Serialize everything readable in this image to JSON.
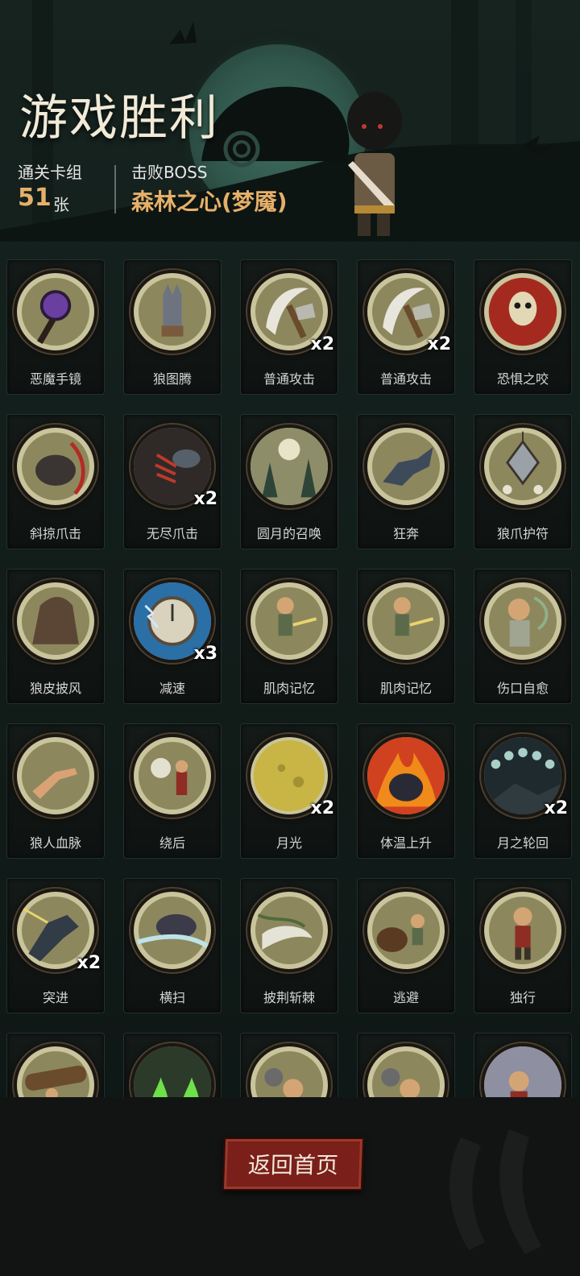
{
  "header": {
    "title": "游戏胜利",
    "deck_label": "通关卡组",
    "deck_count": "51",
    "deck_unit": "张",
    "boss_label": "击败BOSS",
    "boss_name": "森林之心(梦魇)"
  },
  "cards": [
    {
      "name": "恶魔手镜",
      "count": "",
      "icon": "purple-mirror-icon"
    },
    {
      "name": "狼图腾",
      "count": "",
      "icon": "wolf-totem-icon"
    },
    {
      "name": "普通攻击",
      "count": "x2",
      "icon": "axe-slash-icon"
    },
    {
      "name": "普通攻击",
      "count": "x2",
      "icon": "axe-slash-icon"
    },
    {
      "name": "恐惧之咬",
      "count": "",
      "icon": "demon-skull-icon"
    },
    {
      "name": "斜掠爪击",
      "count": "",
      "icon": "werewolf-claw-icon"
    },
    {
      "name": "无尽爪击",
      "count": "x2",
      "icon": "claw-strike-icon"
    },
    {
      "name": "圆月的召唤",
      "count": "",
      "icon": "full-moon-forest-icon"
    },
    {
      "name": "狂奔",
      "count": "",
      "icon": "running-wolf-icon"
    },
    {
      "name": "狼爪护符",
      "count": "",
      "icon": "claw-amulet-icon"
    },
    {
      "name": "狼皮披风",
      "count": "",
      "icon": "wolf-cloak-icon"
    },
    {
      "name": "减速",
      "count": "x3",
      "icon": "clock-lightning-icon"
    },
    {
      "name": "肌肉记忆",
      "count": "",
      "icon": "boy-arrows-icon"
    },
    {
      "name": "肌肉记忆",
      "count": "",
      "icon": "boy-arrows-icon"
    },
    {
      "name": "伤口自愈",
      "count": "",
      "icon": "healing-boy-icon"
    },
    {
      "name": "狼人血脉",
      "count": "",
      "icon": "werewolf-hand-icon"
    },
    {
      "name": "绕后",
      "count": "",
      "icon": "skeleton-ambush-icon"
    },
    {
      "name": "月光",
      "count": "x2",
      "icon": "moonlight-icon"
    },
    {
      "name": "体温上升",
      "count": "",
      "icon": "fire-wolf-icon"
    },
    {
      "name": "月之轮回",
      "count": "x2",
      "icon": "moon-phases-icon"
    },
    {
      "name": "突进",
      "count": "x2",
      "icon": "lunging-wolf-icon"
    },
    {
      "name": "横扫",
      "count": "",
      "icon": "wolf-sweep-icon"
    },
    {
      "name": "披荆斩棘",
      "count": "",
      "icon": "thorn-axe-icon"
    },
    {
      "name": "逃避",
      "count": "",
      "icon": "bear-chase-icon"
    },
    {
      "name": "独行",
      "count": "",
      "icon": "lone-boy-icon"
    },
    {
      "name": "",
      "count": "",
      "icon": "log-carry-icon"
    },
    {
      "name": "",
      "count": "",
      "icon": "green-fire-icon"
    },
    {
      "name": "",
      "count": "",
      "icon": "boy-rock-icon"
    },
    {
      "name": "",
      "count": "",
      "icon": "boy-rock-icon"
    },
    {
      "name": "",
      "count": "",
      "icon": "boy-shield-icon"
    }
  ],
  "palette": {
    "accent_gold": "#e6b069",
    "button_red": "#7a1f19",
    "card_art_bg": "#8d875e"
  },
  "footer": {
    "back_label": "返回首页"
  }
}
